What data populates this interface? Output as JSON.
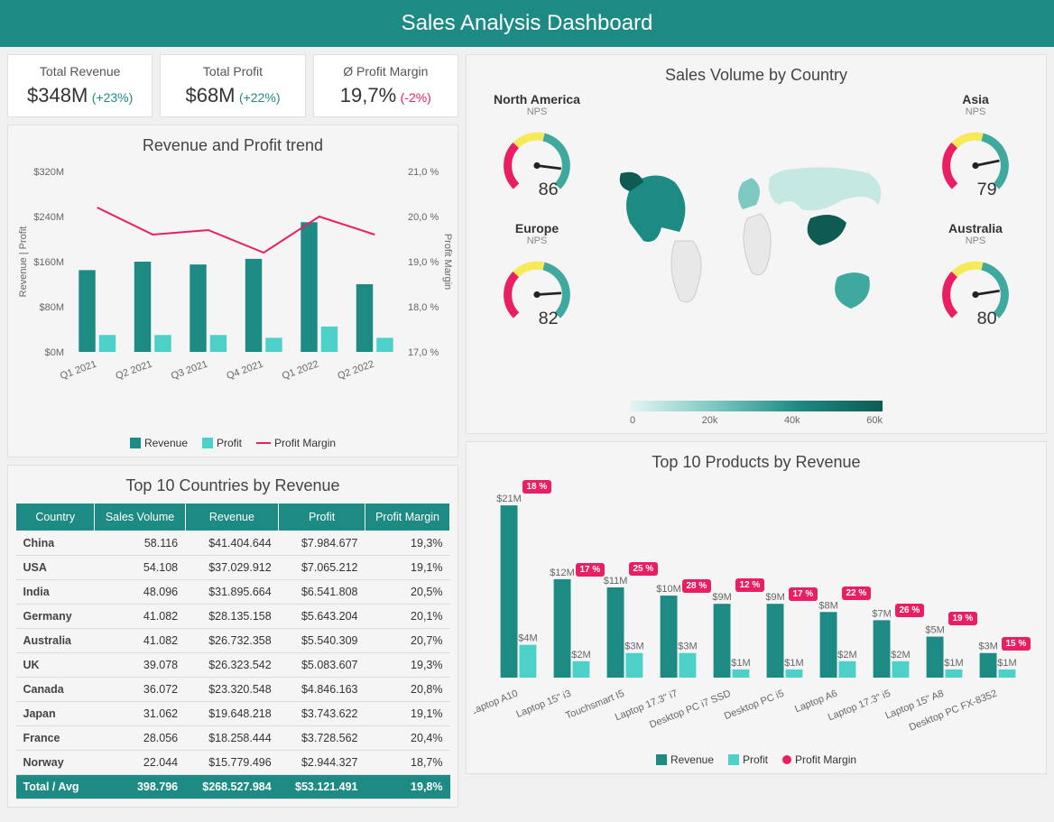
{
  "header": {
    "title": "Sales Analysis Dashboard"
  },
  "kpis": [
    {
      "label": "Total Revenue",
      "value": "$348M",
      "change": "(+23%)",
      "dir": "pos"
    },
    {
      "label": "Total Profit",
      "value": "$68M",
      "change": "(+22%)",
      "dir": "pos"
    },
    {
      "label": "Ø Profit Margin",
      "value": "19,7%",
      "change": "(-2%)",
      "dir": "neg"
    }
  ],
  "trend": {
    "title": "Revenue and Profit trend"
  },
  "countries_table": {
    "title": "Top 10 Countries by Revenue",
    "headers": [
      "Country",
      "Sales Volume",
      "Revenue",
      "Profit",
      "Profit Margin"
    ],
    "rows": [
      [
        "China",
        "58.116",
        "$41.404.644",
        "$7.984.677",
        "19,3%"
      ],
      [
        "USA",
        "54.108",
        "$37.029.912",
        "$7.065.212",
        "19,1%"
      ],
      [
        "India",
        "48.096",
        "$31.895.664",
        "$6.541.808",
        "20,5%"
      ],
      [
        "Germany",
        "41.082",
        "$28.135.158",
        "$5.643.204",
        "20,1%"
      ],
      [
        "Australia",
        "41.082",
        "$26.732.358",
        "$5.540.309",
        "20,7%"
      ],
      [
        "UK",
        "39.078",
        "$26.323.542",
        "$5.083.607",
        "19,3%"
      ],
      [
        "Canada",
        "36.072",
        "$23.320.548",
        "$4.846.163",
        "20,8%"
      ],
      [
        "Japan",
        "31.062",
        "$19.648.218",
        "$3.743.622",
        "19,1%"
      ],
      [
        "France",
        "28.056",
        "$18.258.444",
        "$3.728.562",
        "20,4%"
      ],
      [
        "Norway",
        "22.044",
        "$15.779.496",
        "$2.944.327",
        "18,7%"
      ]
    ],
    "total": [
      "Total / Avg",
      "398.796",
      "$268.527.984",
      "$53.121.491",
      "19,8%"
    ]
  },
  "map": {
    "title": "Sales Volume by Country",
    "gauges": [
      {
        "region": "North America",
        "sub": "NPS",
        "value": "86"
      },
      {
        "region": "Europe",
        "sub": "NPS",
        "value": "82"
      },
      {
        "region": "Asia",
        "sub": "NPS",
        "value": "79"
      },
      {
        "region": "Australia",
        "sub": "NPS",
        "value": "80"
      }
    ],
    "legend_ticks": [
      "0",
      "20k",
      "40k",
      "60k"
    ]
  },
  "products": {
    "title": "Top 10 Products by Revenue"
  },
  "legends": {
    "revenue": "Revenue",
    "profit": "Profit",
    "margin": "Profit Margin"
  },
  "chart_data": [
    {
      "type": "bar",
      "title": "Revenue and Profit trend",
      "categories": [
        "Q1 2021",
        "Q2 2021",
        "Q3 2021",
        "Q4 2021",
        "Q1 2022",
        "Q2 2022"
      ],
      "series": [
        {
          "name": "Revenue",
          "values": [
            145,
            160,
            155,
            165,
            230,
            120
          ],
          "unit": "$M"
        },
        {
          "name": "Profit",
          "values": [
            30,
            30,
            30,
            25,
            45,
            25
          ],
          "unit": "$M"
        }
      ],
      "line": {
        "name": "Profit Margin",
        "values": [
          20.2,
          19.6,
          19.7,
          19.2,
          20.0,
          19.6
        ],
        "unit": "%"
      },
      "ylabel": "Revenue | Profit",
      "ylim": [
        0,
        320
      ],
      "yticks": [
        "$0M",
        "$80M",
        "$160M",
        "$240M",
        "$320M"
      ],
      "ylabel2": "Profit Margin",
      "ylim2": [
        17.0,
        21.0
      ],
      "yticks2": [
        "17,0 %",
        "18,0 %",
        "19,0 %",
        "20,0 %",
        "21,0 %"
      ]
    },
    {
      "type": "bar",
      "title": "Top 10 Products by Revenue",
      "categories": [
        "Laptop A10",
        "Laptop 15\" i3",
        "Touchsmart I5",
        "Laptop 17.3\" i7",
        "Desktop PC i7 SSD",
        "Desktop PC i5",
        "Laptop A6",
        "Laptop 17.3\" i5",
        "Laptop 15\" A8",
        "Desktop PC FX-8352"
      ],
      "series": [
        {
          "name": "Revenue",
          "values": [
            21,
            12,
            11,
            10,
            9,
            9,
            8,
            7,
            5,
            3
          ],
          "unit": "$M"
        },
        {
          "name": "Profit",
          "values": [
            4,
            2,
            3,
            3,
            1,
            1,
            2,
            2,
            1,
            1
          ],
          "unit": "$M"
        }
      ],
      "annotations": {
        "name": "Profit Margin",
        "values": [
          18,
          17,
          25,
          28,
          12,
          17,
          22,
          26,
          19,
          15
        ],
        "unit": "%"
      }
    },
    {
      "type": "map",
      "title": "Sales Volume by Country",
      "gauges": [
        {
          "region": "North America",
          "metric": "NPS",
          "value": 86
        },
        {
          "region": "Europe",
          "metric": "NPS",
          "value": 82
        },
        {
          "region": "Asia",
          "metric": "NPS",
          "value": 79
        },
        {
          "region": "Australia",
          "metric": "NPS",
          "value": 80
        }
      ],
      "color_scale": {
        "min": 0,
        "max": 60000,
        "ticks": [
          0,
          20000,
          40000,
          60000
        ]
      }
    }
  ]
}
